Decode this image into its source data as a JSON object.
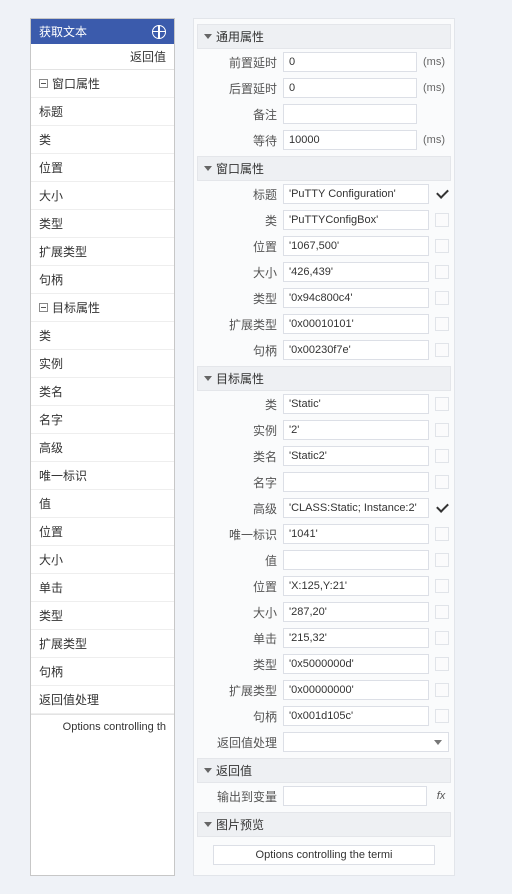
{
  "left": {
    "title": "获取文本",
    "return_label": "返回值",
    "footer_text": "Options controlling th",
    "group1": "窗口属性",
    "group2": "目标属性",
    "items1": [
      "标题",
      "类",
      "位置",
      "大小",
      "类型",
      "扩展类型",
      "句柄"
    ],
    "items2": [
      "类",
      "实例",
      "类名",
      "名字",
      "高级",
      "唯一标识",
      "值",
      "位置",
      "大小",
      "单击",
      "类型",
      "扩展类型",
      "句柄",
      "返回值处理"
    ]
  },
  "right": {
    "general": {
      "header": "通用属性",
      "pre_delay_label": "前置延时",
      "pre_delay_value": "0",
      "post_delay_label": "后置延时",
      "post_delay_value": "0",
      "remark_label": "备注",
      "remark_value": "",
      "wait_label": "等待",
      "wait_value": "10000",
      "unit_ms": "(ms)"
    },
    "window": {
      "header": "窗口属性",
      "title_label": "标题",
      "title_value": "'PuTTY Configuration'",
      "class_label": "类",
      "class_value": "'PuTTYConfigBox'",
      "pos_label": "位置",
      "pos_value": "'1067,500'",
      "size_label": "大小",
      "size_value": "'426,439'",
      "type_label": "类型",
      "type_value": "'0x94c800c4'",
      "ext_label": "扩展类型",
      "ext_value": "'0x00010101'",
      "handle_label": "句柄",
      "handle_value": "'0x00230f7e'"
    },
    "target": {
      "header": "目标属性",
      "class_label": "类",
      "class_value": "'Static'",
      "instance_label": "实例",
      "instance_value": "'2'",
      "classname_label": "类名",
      "classname_value": "'Static2'",
      "name_label": "名字",
      "name_value": "",
      "adv_label": "高级",
      "adv_value": "'CLASS:Static; Instance:2'",
      "uid_label": "唯一标识",
      "uid_value": "'1041'",
      "val_label": "值",
      "val_value": "",
      "pos_label": "位置",
      "pos_value": "'X:125,Y:21'",
      "size_label": "大小",
      "size_value": "'287,20'",
      "click_label": "单击",
      "click_value": "'215,32'",
      "type_label": "类型",
      "type_value": "'0x5000000d'",
      "ext_label": "扩展类型",
      "ext_value": "'0x00000000'",
      "handle_label": "句柄",
      "handle_value": "'0x001d105c'",
      "retproc_label": "返回值处理"
    },
    "return": {
      "header": "返回值",
      "outvar_label": "输出到变量",
      "outvar_value": "",
      "fx_label": "fx"
    },
    "preview": {
      "header": "图片预览",
      "text": "Options controlling the termi"
    }
  }
}
